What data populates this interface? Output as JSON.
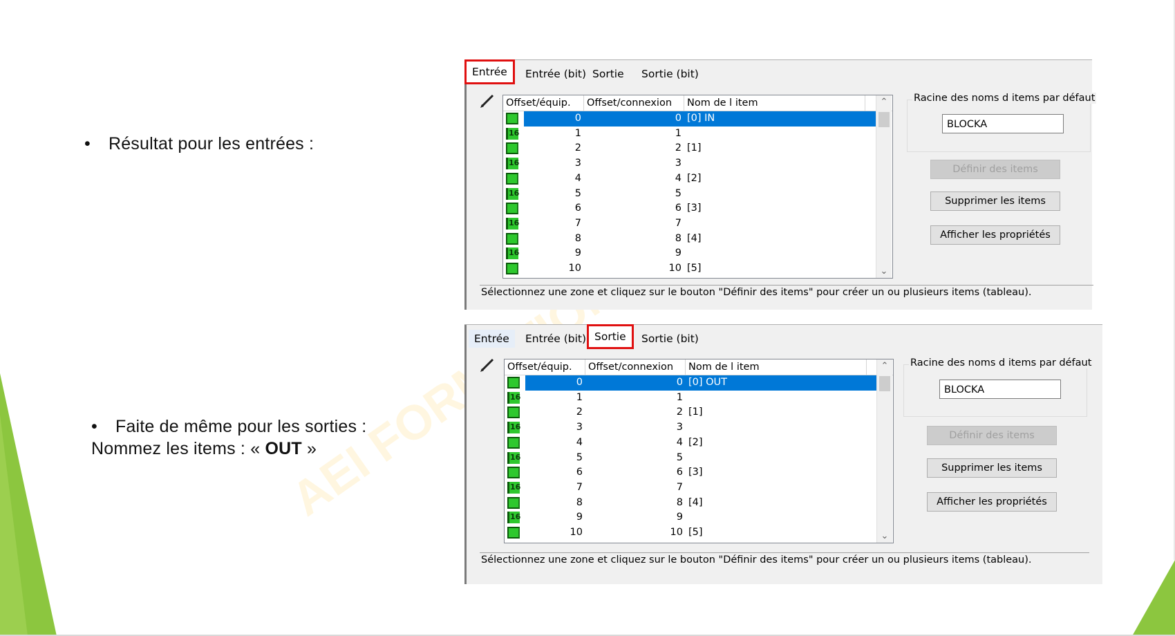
{
  "slide": {
    "bullet1": "Résultat pour les entrées :",
    "bullet2_line1": "Faite de même pour les sorties :",
    "bullet2_line2_prefix": "Nommez les items : «",
    "bullet2_bold": "OUT",
    "bullet2_line2_suffix": "»",
    "bullet_char": "•",
    "watermark": "AEI FORMATION",
    "accent_green": "#8cc63f"
  },
  "panels": [
    {
      "tabs": [
        "Entrée",
        "Entrée (bit)",
        "Sortie",
        "Sortie (bit)"
      ],
      "selected_tab": 0,
      "columns": [
        "Offset/équip.",
        "Offset/connexion",
        "Nom de l item"
      ],
      "rows": [
        {
          "indicator": "",
          "equip": "0",
          "conn": "0",
          "name": "[0] IN",
          "selected": true
        },
        {
          "indicator": "16",
          "equip": "1",
          "conn": "1",
          "name": ""
        },
        {
          "indicator": "",
          "equip": "2",
          "conn": "2",
          "name": "[1]"
        },
        {
          "indicator": "16",
          "equip": "3",
          "conn": "3",
          "name": ""
        },
        {
          "indicator": "",
          "equip": "4",
          "conn": "4",
          "name": "[2]"
        },
        {
          "indicator": "16",
          "equip": "5",
          "conn": "5",
          "name": ""
        },
        {
          "indicator": "",
          "equip": "6",
          "conn": "6",
          "name": "[3]"
        },
        {
          "indicator": "16",
          "equip": "7",
          "conn": "7",
          "name": ""
        },
        {
          "indicator": "",
          "equip": "8",
          "conn": "8",
          "name": "[4]"
        },
        {
          "indicator": "16",
          "equip": "9",
          "conn": "9",
          "name": ""
        },
        {
          "indicator": "",
          "equip": "10",
          "conn": "10",
          "name": "[5]"
        }
      ],
      "root_label": "Racine des noms d items par défaut",
      "root_value": "BLOCKA",
      "buttons": [
        "Définir des items",
        "Supprimer les items",
        "Afficher les propriétés"
      ],
      "status": "Sélectionnez une zone et cliquez sur le bouton \"Définir des items\" pour créer un ou plusieurs items (tableau)."
    },
    {
      "tabs": [
        "Entrée",
        "Entrée (bit)",
        "Sortie",
        "Sortie (bit)"
      ],
      "selected_tab": 2,
      "columns": [
        "Offset/équip.",
        "Offset/connexion",
        "Nom de l item"
      ],
      "rows": [
        {
          "indicator": "",
          "equip": "0",
          "conn": "0",
          "name": "[0] OUT",
          "selected": true
        },
        {
          "indicator": "16",
          "equip": "1",
          "conn": "1",
          "name": ""
        },
        {
          "indicator": "",
          "equip": "2",
          "conn": "2",
          "name": "[1]"
        },
        {
          "indicator": "16",
          "equip": "3",
          "conn": "3",
          "name": ""
        },
        {
          "indicator": "",
          "equip": "4",
          "conn": "4",
          "name": "[2]"
        },
        {
          "indicator": "16",
          "equip": "5",
          "conn": "5",
          "name": ""
        },
        {
          "indicator": "",
          "equip": "6",
          "conn": "6",
          "name": "[3]"
        },
        {
          "indicator": "16",
          "equip": "7",
          "conn": "7",
          "name": ""
        },
        {
          "indicator": "",
          "equip": "8",
          "conn": "8",
          "name": "[4]"
        },
        {
          "indicator": "16",
          "equip": "9",
          "conn": "9",
          "name": ""
        },
        {
          "indicator": "",
          "equip": "10",
          "conn": "10",
          "name": "[5]"
        }
      ],
      "root_label": "Racine des noms d items par défaut",
      "root_value": "BLOCKA",
      "buttons": [
        "Définir des items",
        "Supprimer les items",
        "Afficher les propriétés"
      ],
      "status": "Sélectionnez une zone et cliquez sur le bouton \"Définir des items\" pour créer un ou plusieurs items (tableau)."
    }
  ]
}
